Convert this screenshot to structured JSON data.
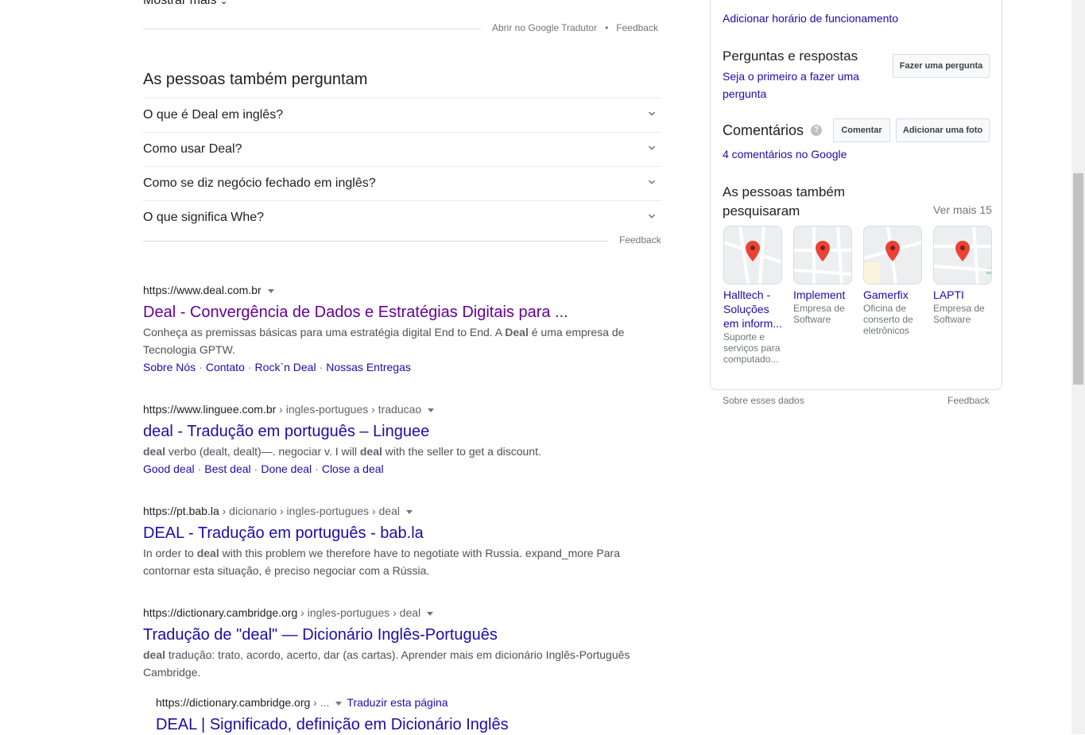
{
  "top": {
    "show_more": "Mostrar mais",
    "translate_link": "Abrir no Google Tradutor",
    "dot": "•",
    "feedback": "Feedback"
  },
  "paa": {
    "title": "As pessoas também perguntam",
    "questions": [
      "O que é Deal em inglês?",
      "Como usar Deal?",
      "Como se diz negócio fechado em inglês?",
      "O que significa Whe?"
    ],
    "feedback": "Feedback"
  },
  "results": [
    {
      "url": "https://www.deal.com.br",
      "path": "",
      "title": "Deal - Convergência de Dados e Estratégias Digitais para ...",
      "snippet_pre": "Conheça as premissas básicas para uma estratégia digital End to End. A ",
      "snippet_bold": "Deal",
      "snippet_post": " é uma empresa de Tecnologia GPTW.",
      "sitelinks": [
        "Sobre Nós",
        "Contato",
        "Rock`n Deal",
        "Nossas Entregas"
      ]
    },
    {
      "url": "https://www.linguee.com.br",
      "path": " › ingles-portugues › traducao",
      "title": "deal - Tradução em português – Linguee",
      "snippet_bold": "deal",
      "snippet_mid": " verbo (dealt, dealt)—. negociar v. I will ",
      "snippet_bold2": "deal",
      "snippet_post": " with the seller to get a discount.",
      "sitelinks": [
        "Good deal",
        "Best deal",
        "Done deal",
        "Close a deal"
      ]
    },
    {
      "url": "https://pt.bab.la",
      "path": " › dicionario › ingles-portugues › deal",
      "title": "DEAL - Tradução em português - bab.la",
      "snippet_pre": "In order to ",
      "snippet_bold": "deal",
      "snippet_post": " with this problem we therefore have to negotiate with Russia. expand_more Para contornar esta situação, é preciso negociar com a Rússia."
    },
    {
      "url": "https://dictionary.cambridge.org",
      "path": " › ingles-portugues › deal",
      "title": "Tradução de \"deal\" — Dicionário Inglês-Português",
      "snippet_bold": "deal",
      "snippet_post": " tradução: trato, acordo, acerto, dar (as cartas). Aprender mais em dicionário Inglês-Português Cambridge."
    },
    {
      "url": "https://dictionary.cambridge.org",
      "path": " › ...",
      "translate": "Traduzir esta página",
      "title": "DEAL | Significado, definição em Dicionário Inglês"
    }
  ],
  "sep": "·",
  "panel": {
    "add_hours": "Adicionar horário de funcionamento",
    "qa_title": "Perguntas e respostas",
    "qa_link": "Seja o primeiro a fazer uma pergunta",
    "ask_button": "Fazer uma pergunta",
    "reviews_title": "Comentários",
    "help": "?",
    "comment_button": "Comentar",
    "add_photo_button": "Adicionar uma foto",
    "reviews_link": "4 comentários no Google",
    "also_search_title": "As pessoas também pesquisaram",
    "see_more": "Ver mais 15",
    "places": [
      {
        "name": "Halltech - Soluções em inform...",
        "type": "Suporte e serviços para computado..."
      },
      {
        "name": "Implement",
        "type": "Empresa de Software"
      },
      {
        "name": "Gamerfix",
        "type": "Oficina de conserto de eletrônicos"
      },
      {
        "name": "LAPTI",
        "type": "Empresa de Software"
      }
    ],
    "about_data": "Sobre esses dados",
    "feedback": "Feedback"
  }
}
